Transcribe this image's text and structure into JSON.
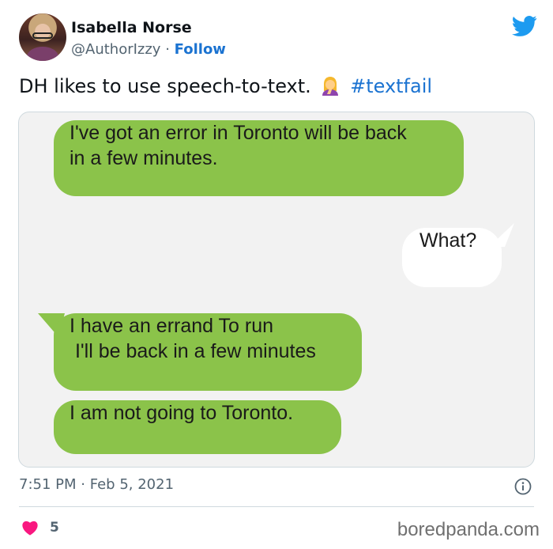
{
  "author": {
    "name": "Isabella Norse",
    "handle": "@AuthorIzzy",
    "separator": "·",
    "follow_label": "Follow"
  },
  "tweet": {
    "text": "DH likes to use speech-to-text.",
    "emoji": "woman-facepalming-emoji",
    "hashtag": "#textfail"
  },
  "messages": [
    {
      "side": "sent",
      "lines": [
        "I've got an error in Toronto will be back",
        "in a few minutes."
      ]
    },
    {
      "side": "received",
      "lines": [
        "What?"
      ]
    },
    {
      "side": "sent",
      "lines": [
        "I have an errand To run",
        " I'll be back in a few minutes"
      ]
    },
    {
      "side": "sent",
      "lines": [
        "I am not going to Toronto."
      ]
    }
  ],
  "meta": {
    "time": "7:51 PM",
    "separator": "·",
    "date": "Feb 5, 2021"
  },
  "engagement": {
    "likes": "5"
  },
  "watermark": "boredpanda.com",
  "icons": {
    "bird": "twitter-bird-icon",
    "info": "info-icon",
    "heart": "heart-icon"
  },
  "colors": {
    "accent": "#1b73d1",
    "bird": "#1d9bf0",
    "sent_bubble": "#8bc34a",
    "received_bubble": "#ffffff",
    "heart": "#f91880"
  }
}
